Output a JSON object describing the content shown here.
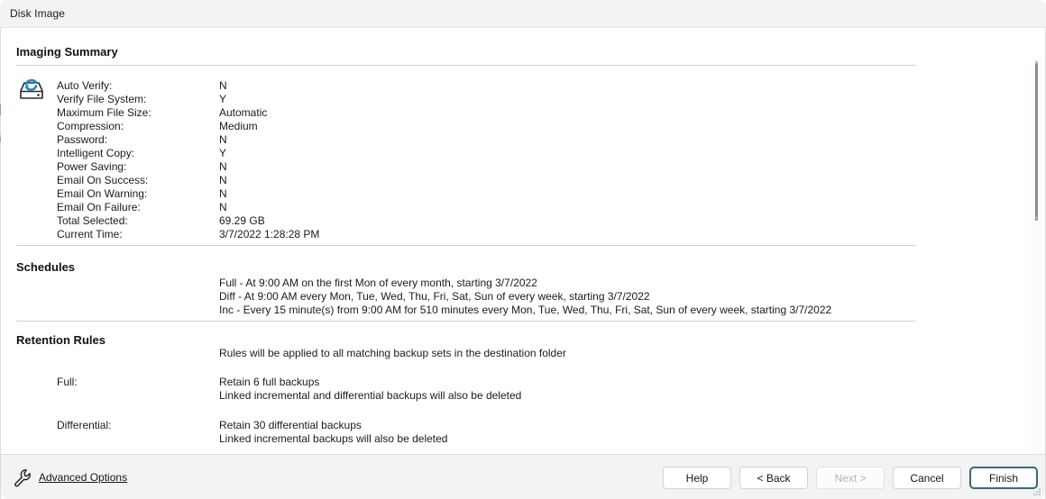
{
  "window": {
    "title": "Disk Image"
  },
  "page": {
    "title": "Imaging Summary"
  },
  "summary": {
    "rows": [
      {
        "label": "Auto Verify:",
        "value": "N"
      },
      {
        "label": "Verify File System:",
        "value": "Y"
      },
      {
        "label": "Maximum File Size:",
        "value": "Automatic"
      },
      {
        "label": "Compression:",
        "value": "Medium"
      },
      {
        "label": "Password:",
        "value": "N"
      },
      {
        "label": "Intelligent Copy:",
        "value": "Y"
      },
      {
        "label": "Power Saving:",
        "value": "N"
      },
      {
        "label": "Email On Success:",
        "value": "N"
      },
      {
        "label": "Email On Warning:",
        "value": "N"
      },
      {
        "label": "Email On Failure:",
        "value": "N"
      },
      {
        "label": "Total Selected:",
        "value": "69.29 GB"
      },
      {
        "label": "Current Time:",
        "value": "3/7/2022 1:28:28 PM"
      }
    ]
  },
  "schedules": {
    "heading": "Schedules",
    "lines": [
      "Full - At 9:00 AM on the first Mon of every month, starting 3/7/2022",
      "Diff - At 9:00 AM every Mon, Tue, Wed, Thu, Fri, Sat, Sun of every week, starting 3/7/2022",
      "Inc - Every 15 minute(s) from 9:00 AM for 510 minutes every Mon, Tue, Wed, Thu, Fri, Sat, Sun of every week, starting 3/7/2022"
    ]
  },
  "retention": {
    "heading": "Retention Rules",
    "note": "Rules will be applied to all matching backup sets in the destination folder",
    "full": {
      "label": "Full:",
      "lines": [
        "Retain 6 full backups",
        "Linked incremental and differential backups will also be deleted"
      ]
    },
    "differential": {
      "label": "Differential:",
      "lines": [
        "Retain 30 differential backups",
        "Linked incremental backups will also be deleted"
      ]
    }
  },
  "footer": {
    "advanced_options": "Advanced Options",
    "buttons": [
      {
        "label": "Help",
        "state": "enabled"
      },
      {
        "label": "< Back",
        "state": "enabled"
      },
      {
        "label": "Next >",
        "state": "disabled"
      },
      {
        "label": "Cancel",
        "state": "enabled"
      },
      {
        "label": "Finish",
        "state": "default"
      }
    ]
  },
  "icons": {
    "disk": "disk-refresh-icon",
    "wrench": "wrench-icon"
  },
  "colors": {
    "accent_blue": "#1e8bc3",
    "default_button_border": "#3b6a72",
    "chrome": "#f3f3f3",
    "text": "#1b1b1b"
  }
}
